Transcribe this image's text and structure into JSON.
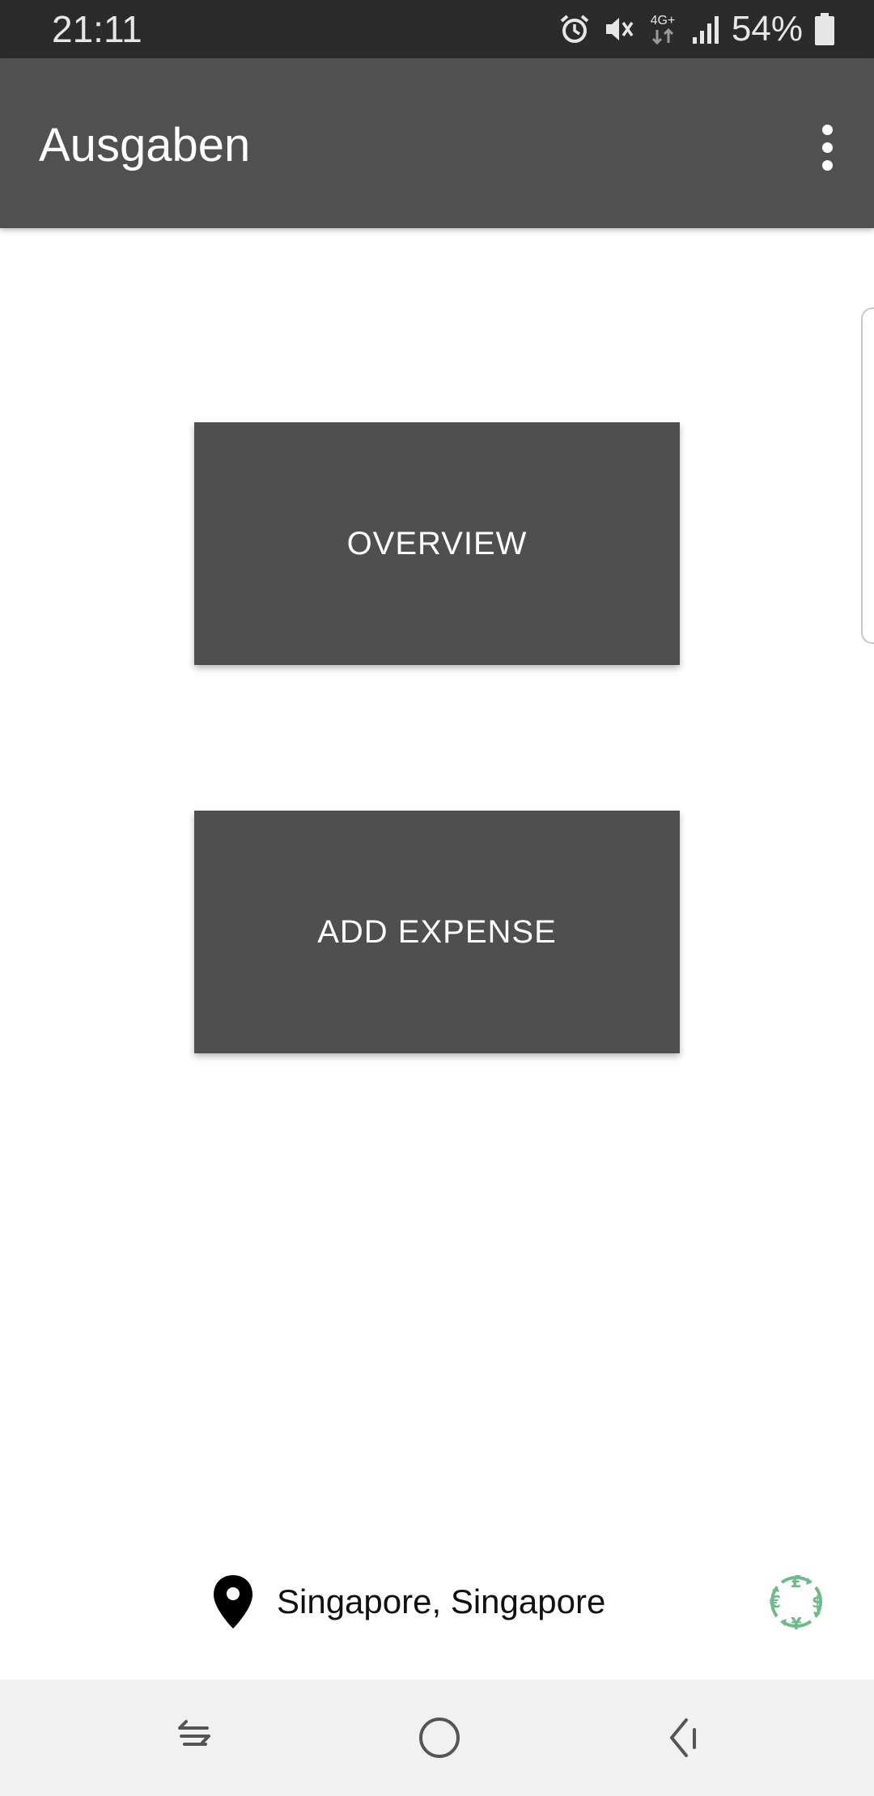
{
  "status_bar": {
    "time": "21:11",
    "battery": "54%",
    "icons": [
      "alarm-icon",
      "mute-icon",
      "4g-data-icon",
      "signal-icon",
      "battery-icon"
    ],
    "network_label": "4G+"
  },
  "app_bar": {
    "title": "Ausgaben",
    "menu_icon": "more-vert-icon"
  },
  "main": {
    "buttons": [
      {
        "label": "OVERVIEW"
      },
      {
        "label": "ADD EXPENSE"
      }
    ]
  },
  "footer": {
    "location": "Singapore, Singapore",
    "location_icon": "location-pin-icon",
    "currency_icon": "currency-exchange-icon"
  },
  "nav_bar": {
    "icons": [
      "recent-apps-icon",
      "home-icon",
      "back-icon"
    ]
  },
  "colors": {
    "status_bar": "#2b2b2b",
    "app_bar": "#505050",
    "button": "#4f4f4f",
    "currency_accent": "#6fba8a",
    "nav_bar": "#f1f1f1"
  }
}
